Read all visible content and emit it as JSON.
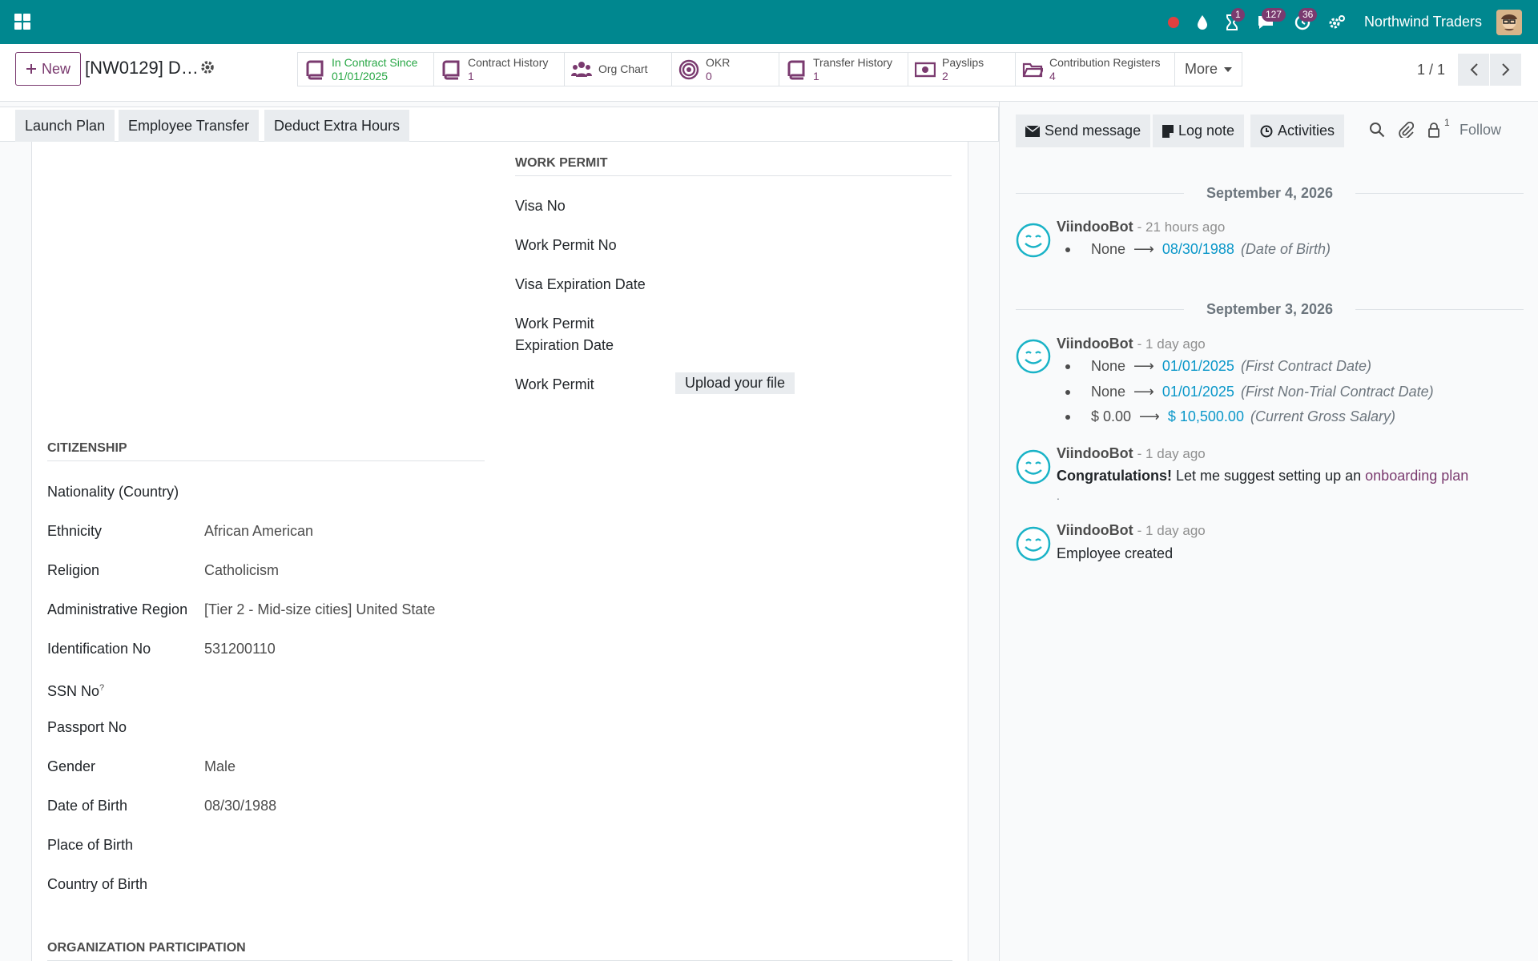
{
  "navbar": {
    "company": "Northwind Traders",
    "badges": {
      "activities": "1",
      "messages": "127",
      "clock": "36"
    }
  },
  "control": {
    "new_label": "New",
    "record_title": "[NW0129] D…",
    "smart_buttons": [
      {
        "label": "In Contract Since",
        "value": "01/01/2025",
        "icon": "book-icon"
      },
      {
        "label": "Contract History",
        "value": "1",
        "icon": "book-icon"
      },
      {
        "label": "Org Chart",
        "value": "",
        "icon": "users-icon"
      },
      {
        "label": "OKR",
        "value": "0",
        "icon": "target-icon"
      },
      {
        "label": "Transfer History",
        "value": "1",
        "icon": "book-icon"
      },
      {
        "label": "Payslips",
        "value": "2",
        "icon": "money-icon"
      },
      {
        "label": "Contribution Registers",
        "value": "4",
        "icon": "folder-icon"
      }
    ],
    "more_label": "More",
    "pager": "1 / 1"
  },
  "actions": {
    "launch_plan": "Launch Plan",
    "employee_transfer": "Employee Transfer",
    "deduct_extra_hours": "Deduct Extra Hours"
  },
  "work_permit": {
    "title": "WORK PERMIT",
    "visa_no": "Visa No",
    "work_permit_no": "Work Permit No",
    "visa_expiration": "Visa Expiration Date",
    "permit_expiration_1": "Work Permit",
    "permit_expiration_2": "Expiration Date",
    "work_permit": "Work Permit",
    "upload": "Upload your file"
  },
  "citizenship": {
    "title": "CITIZENSHIP",
    "nationality": "Nationality (Country)",
    "ethnicity_label": "Ethnicity",
    "ethnicity_value": "African American",
    "religion_label": "Religion",
    "religion_value": "Catholicism",
    "region_label": "Administrative Region",
    "region_value": "[Tier 2 - Mid-size cities] United State",
    "id_label": "Identification No",
    "id_value": "531200110",
    "ssn_label": "SSN No",
    "ssn_help": "?",
    "passport_label": "Passport No",
    "gender_label": "Gender",
    "gender_value": "Male",
    "dob_label": "Date of Birth",
    "dob_value": "08/30/1988",
    "pob_label": "Place of Birth",
    "cob_label": "Country of Birth"
  },
  "org_participation": {
    "title": "ORGANIZATION PARTICIPATION"
  },
  "chatter": {
    "send_message": "Send message",
    "log_note": "Log note",
    "activities": "Activities",
    "followers_count": "1",
    "follow": "Follow",
    "day1": "September 4, 2026",
    "day2": "September 3, 2026",
    "messages": [
      {
        "author": "ViindooBot",
        "date": "- 21 hours ago"
      },
      {
        "author": "ViindooBot",
        "date": "- 1 day ago"
      },
      {
        "author": "ViindooBot",
        "date": "- 1 day ago"
      },
      {
        "author": "ViindooBot",
        "date": "- 1 day ago"
      }
    ],
    "tracking": [
      {
        "old": "None",
        "new": "08/30/1988",
        "field": "(Date of Birth)"
      },
      {
        "old": "None",
        "new": "01/01/2025",
        "field": "(First Contract Date)"
      },
      {
        "old": "None",
        "new": "01/01/2025",
        "field": "(First Non-Trial Contract Date)"
      },
      {
        "old": "$ 0.00",
        "new": "$ 10,500.00",
        "field": "(Current Gross Salary)"
      }
    ],
    "congrats_bold": "Congratulations!",
    "congrats_text": " Let me suggest setting up an ",
    "congrats_link": "onboarding plan",
    "congrats_end": ".",
    "employee_created": "Employee created"
  },
  "colors": {
    "navbar": "#00878f",
    "accent": "#7a3a6f",
    "tracking_new": "#0a97c9"
  }
}
